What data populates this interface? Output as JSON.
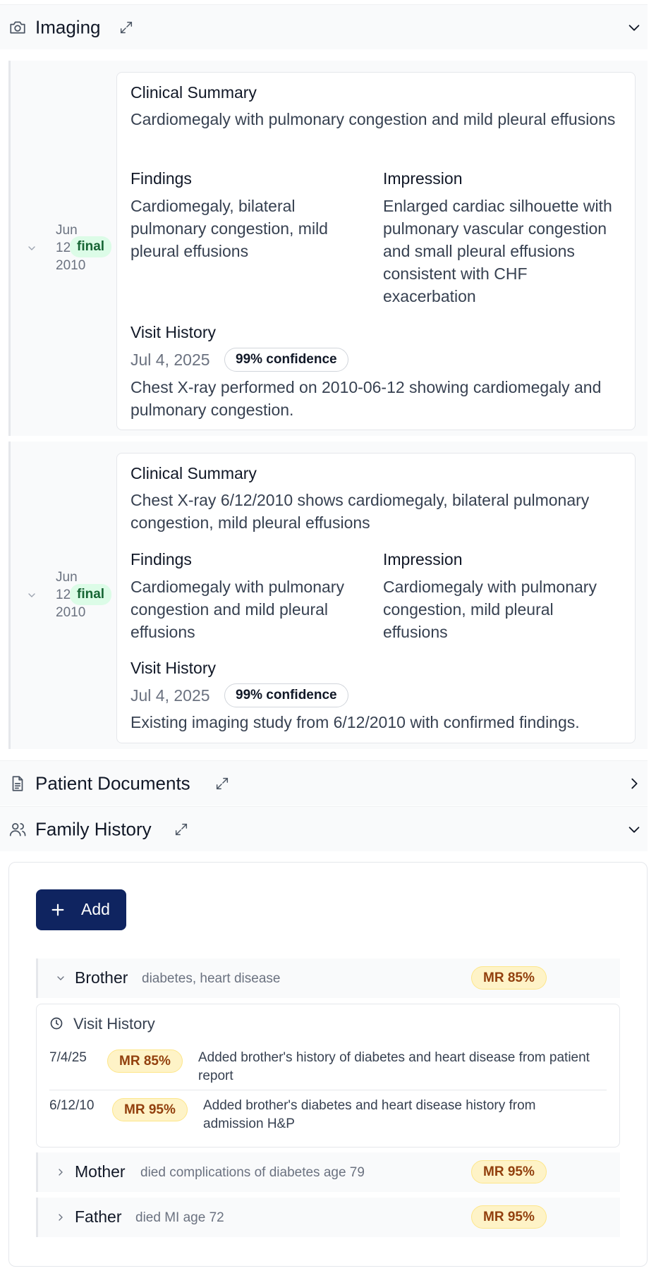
{
  "imaging": {
    "title": "Imaging",
    "studies": [
      {
        "date": "Jun 12, 2010",
        "status": "final",
        "clinical_summary_label": "Clinical Summary",
        "clinical_summary": "Cardiomegaly with pulmonary congestion and mild pleural effusions",
        "findings_label": "Findings",
        "findings": "Cardiomegaly, bilateral pulmonary congestion, mild pleural effusions",
        "impression_label": "Impression",
        "impression": "Enlarged cardiac silhouette with pulmonary vascular congestion and small pleural effusions consistent with CHF exacerbation",
        "visit_history_label": "Visit History",
        "visit_date": "Jul 4, 2025",
        "confidence": "99% confidence",
        "note": "Chest X-ray performed on 2010-06-12 showing cardiomegaly and pulmonary congestion."
      },
      {
        "date": "Jun 12, 2010",
        "status": "final",
        "clinical_summary_label": "Clinical Summary",
        "clinical_summary": "Chest X-ray 6/12/2010 shows cardiomegaly, bilateral pulmonary congestion, mild pleural effusions",
        "findings_label": "Findings",
        "findings": "Cardiomegaly with pulmonary congestion and mild pleural effusions",
        "impression_label": "Impression",
        "impression": "Cardiomegaly with pulmonary congestion, mild pleural effusions",
        "visit_history_label": "Visit History",
        "visit_date": "Jul 4, 2025",
        "confidence": "99% confidence",
        "note": "Existing imaging study from 6/12/2010 with confirmed findings."
      }
    ]
  },
  "patient_documents": {
    "title": "Patient Documents"
  },
  "family_history": {
    "title": "Family History",
    "add_label": "Add",
    "members": [
      {
        "relation": "Brother",
        "description": "diabetes, heart disease",
        "badge": "MR 85%"
      },
      {
        "relation": "Mother",
        "description": "died complications of diabetes age 79",
        "badge": "MR 95%"
      },
      {
        "relation": "Father",
        "description": "died MI age 72",
        "badge": "MR 95%"
      }
    ],
    "visit_history": {
      "title": "Visit History",
      "entries": [
        {
          "date": "7/4/25",
          "badge": "MR 85%",
          "text": "Added brother's history of diabetes and heart disease from patient report"
        },
        {
          "date": "6/12/10",
          "badge": "MR 95%",
          "text": "Added brother's diabetes and heart disease history from admission H&P"
        }
      ]
    }
  },
  "colors": {
    "accent_button": "#0f2460",
    "final_badge_bg": "#dcfce7",
    "final_badge_text": "#166534",
    "mr_badge_bg": "#fef3c7",
    "mr_badge_text": "#92400e"
  }
}
